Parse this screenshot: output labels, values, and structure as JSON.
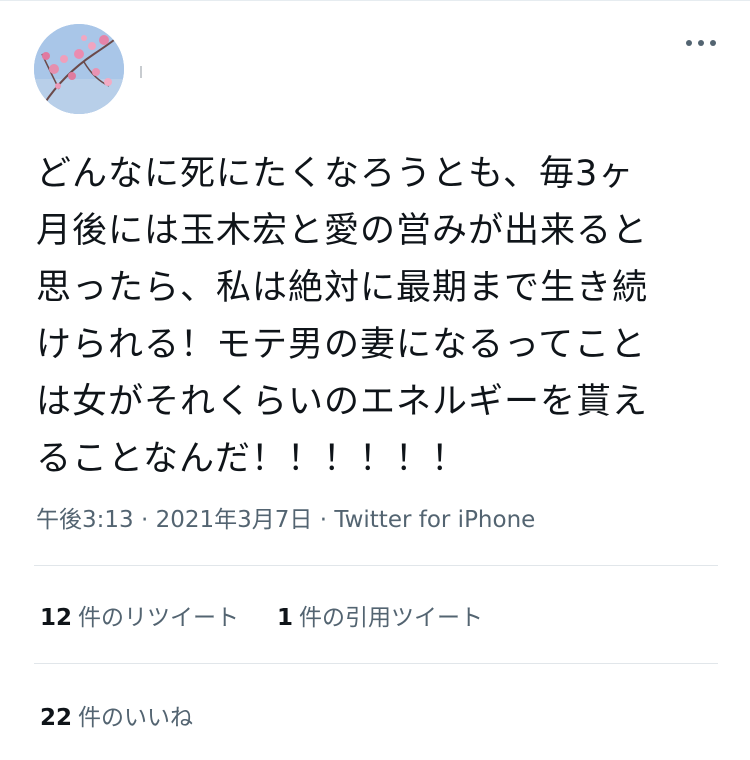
{
  "tweet": {
    "text": "どんなに死にたくなろうとも、毎3ヶ\n月後には玉木宏と愛の営みが出来ると\n思ったら、私は絶対に最期まで生き続\nけられる！モテ男の妻になるってこと\nは女がそれくらいのエネルギーを貰え\nることなんだ！！！！！！",
    "time": "午後3:13",
    "date": "2021年3月7日",
    "source": "Twitter for iPhone",
    "separator": "·"
  },
  "stats": {
    "retweets": {
      "count": "12",
      "label": "件のリツイート"
    },
    "quotes": {
      "count": "1",
      "label": "件の引用ツイート"
    },
    "likes": {
      "count": "22",
      "label": "件のいいね"
    }
  },
  "icons": {
    "avatar": "avatar-image",
    "more": "more-horizontal-icon"
  },
  "colors": {
    "text": "#0f1419",
    "secondary": "#536471",
    "divider": "#e1e6ea"
  }
}
